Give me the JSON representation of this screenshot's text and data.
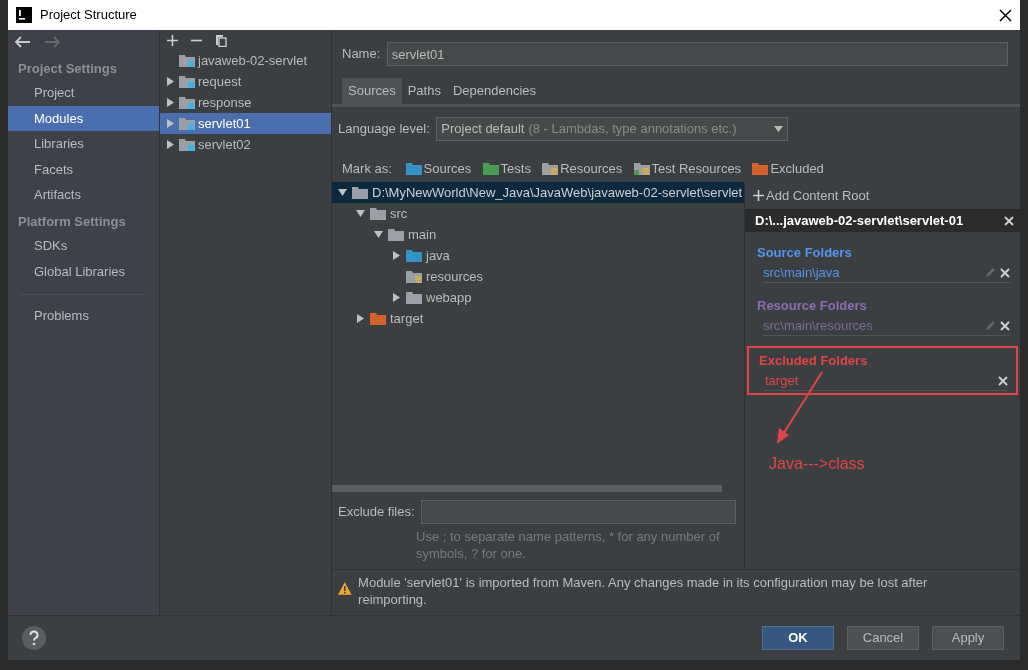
{
  "window": {
    "title": "Project Structure"
  },
  "sidebar": {
    "sections": [
      {
        "title": "Project Settings",
        "items": [
          {
            "label": "Project",
            "selected": false
          },
          {
            "label": "Modules",
            "selected": true
          },
          {
            "label": "Libraries",
            "selected": false
          },
          {
            "label": "Facets",
            "selected": false
          },
          {
            "label": "Artifacts",
            "selected": false
          }
        ]
      },
      {
        "title": "Platform Settings",
        "items": [
          {
            "label": "SDKs",
            "selected": false
          },
          {
            "label": "Global Libraries",
            "selected": false
          }
        ]
      },
      {
        "items": [
          {
            "label": "Problems",
            "selected": false
          }
        ]
      }
    ]
  },
  "modules": {
    "items": [
      {
        "label": "javaweb-02-servlet",
        "expandable": false,
        "selected": false
      },
      {
        "label": "request",
        "expandable": true,
        "selected": false
      },
      {
        "label": "response",
        "expandable": true,
        "selected": false
      },
      {
        "label": "servlet01",
        "expandable": true,
        "selected": true
      },
      {
        "label": "servlet02",
        "expandable": true,
        "selected": false
      }
    ]
  },
  "name_field": {
    "label": "Name:",
    "value": "servlet01"
  },
  "tabs": [
    {
      "label": "Sources",
      "selected": true
    },
    {
      "label": "Paths",
      "selected": false
    },
    {
      "label": "Dependencies",
      "selected": false
    }
  ],
  "language_level": {
    "label": "Language level:",
    "value": "Project default",
    "detail": "(8 - Lambdas, type annotations etc.)"
  },
  "mark_as": {
    "label": "Mark as:",
    "buttons": [
      {
        "label": "Sources",
        "kind": "source"
      },
      {
        "label": "Tests",
        "kind": "test"
      },
      {
        "label": "Resources",
        "kind": "resources"
      },
      {
        "label": "Test Resources",
        "kind": "testresources"
      },
      {
        "label": "Excluded",
        "kind": "excluded"
      }
    ]
  },
  "file_tree": [
    {
      "label": "D:\\MyNewWorld\\New_Java\\JavaWeb\\javaweb-02-servlet\\servlet",
      "kind": "root",
      "expanded": true,
      "selected": true,
      "children": [
        {
          "label": "src",
          "kind": "plain",
          "expanded": true,
          "selected": false,
          "children": [
            {
              "label": "main",
              "kind": "plain",
              "expanded": true,
              "selected": false,
              "children": [
                {
                  "label": "java",
                  "kind": "source",
                  "expanded": false,
                  "selected": false
                },
                {
                  "label": "resources",
                  "kind": "resources",
                  "selected": false
                },
                {
                  "label": "webapp",
                  "kind": "plain",
                  "expanded": false,
                  "selected": false
                }
              ]
            }
          ]
        },
        {
          "label": "target",
          "kind": "excluded",
          "expanded": false,
          "selected": false
        }
      ]
    }
  ],
  "content_root": {
    "add_label": "Add Content Root",
    "path": "D:\\...javaweb-02-servlet\\servlet-01",
    "groups": [
      {
        "title": "Source Folders",
        "kind": "source",
        "highlighted": false,
        "entries": [
          {
            "path": "src\\main\\java",
            "editable": true
          }
        ]
      },
      {
        "title": "Resource Folders",
        "kind": "resources",
        "highlighted": false,
        "entries": [
          {
            "path": "src\\main\\resources",
            "editable": true
          }
        ]
      },
      {
        "title": "Excluded Folders",
        "kind": "excluded",
        "highlighted": true,
        "entries": [
          {
            "path": "target",
            "editable": false
          }
        ]
      }
    ]
  },
  "annotation": {
    "text": "Java--->class"
  },
  "exclude_files": {
    "label": "Exclude files:",
    "hint": "Use ; to separate name patterns, * for any number of symbols, ? for one."
  },
  "warning": "Module 'servlet01' is imported from Maven. Any changes made in its configuration may be lost after reimporting.",
  "buttons": [
    {
      "label": "OK",
      "kind": "primary"
    },
    {
      "label": "Cancel",
      "kind": "default"
    },
    {
      "label": "Apply",
      "kind": "default"
    }
  ]
}
